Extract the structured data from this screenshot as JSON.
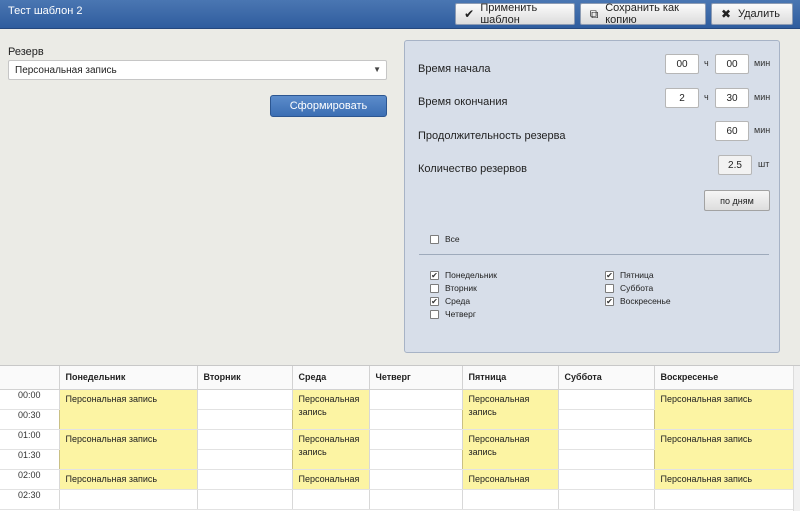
{
  "window": {
    "title": "Тест шаблон 2"
  },
  "toolbar": {
    "apply_label": "Применить шаблон",
    "save_copy_label": "Сохранить как копию",
    "delete_label": "Удалить"
  },
  "form": {
    "reserve_label": "Резерв",
    "reserve_value": "Персональная запись",
    "generate_label": "Сформировать"
  },
  "panel": {
    "start_label": "Время начала",
    "start_hours": "00",
    "start_minutes": "00",
    "end_label": "Время окончания",
    "end_hours": "2",
    "end_minutes": "30",
    "duration_label": "Продолжительность резерва",
    "duration_value": "60",
    "count_label": "Количество резервов",
    "count_value": "2.5",
    "unit_hours": "ч",
    "unit_minutes": "мин",
    "unit_pieces": "шт",
    "by_days_label": "по дням",
    "all_label": "Все",
    "all_checked": false,
    "days": [
      {
        "label": "Понедельник",
        "checked": true
      },
      {
        "label": "Вторник",
        "checked": false
      },
      {
        "label": "Среда",
        "checked": true
      },
      {
        "label": "Четверг",
        "checked": false
      },
      {
        "label": "Пятница",
        "checked": true
      },
      {
        "label": "Суббота",
        "checked": false
      },
      {
        "label": "Воскресенье",
        "checked": true
      }
    ]
  },
  "schedule": {
    "headers": [
      "",
      "Понедельник",
      "Вторник",
      "Среда",
      "Четверг",
      "Пятница",
      "Суббота",
      "Воскресенье"
    ],
    "times": [
      "00:00",
      "00:30",
      "01:00",
      "01:30",
      "02:00",
      "02:30"
    ],
    "event_text": "Персональная запись",
    "event_text_partial": "Персональная"
  },
  "colors": {
    "title_bar": "#3a67a8",
    "primary_button": "#4a7cc0",
    "event_fill": "#fcf4a3",
    "panel_bg": "#d7dee9"
  }
}
